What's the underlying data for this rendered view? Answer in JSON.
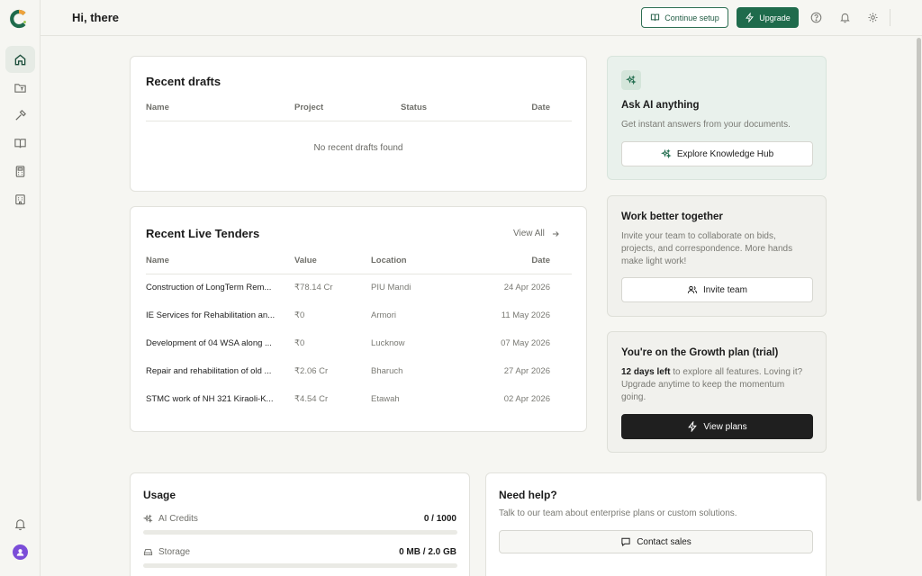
{
  "header": {
    "greeting": "Hi, there",
    "continue_setup": "Continue setup",
    "upgrade": "Upgrade"
  },
  "sidebar": {
    "items": [
      {
        "name": "home",
        "icon": "home-icon",
        "active": true
      },
      {
        "name": "projects",
        "icon": "folder-icon"
      },
      {
        "name": "tools",
        "icon": "hammer-icon"
      },
      {
        "name": "library",
        "icon": "book-icon"
      },
      {
        "name": "calculator",
        "icon": "calculator-icon"
      },
      {
        "name": "organization",
        "icon": "building-icon"
      }
    ]
  },
  "drafts": {
    "title": "Recent drafts",
    "columns": [
      "Name",
      "Project",
      "Status",
      "Date"
    ],
    "empty": "No recent drafts found"
  },
  "tenders": {
    "title": "Recent Live Tenders",
    "view_all": "View All",
    "columns": [
      "Name",
      "Value",
      "Location",
      "Date"
    ],
    "rows": [
      {
        "name": "Construction of LongTerm Rem...",
        "value": "₹78.14 Cr",
        "location": "PIU Mandi",
        "date": "24 Apr 2026"
      },
      {
        "name": "IE Services for Rehabilitation an...",
        "value": "₹0",
        "location": "Armori",
        "date": "11 May 2026"
      },
      {
        "name": "Development of 04 WSA along ...",
        "value": "₹0",
        "location": "Lucknow",
        "date": "07 May 2026"
      },
      {
        "name": "Repair and rehabilitation of old ...",
        "value": "₹2.06 Cr",
        "location": "Bharuch",
        "date": "27 Apr 2026"
      },
      {
        "name": "STMC work of NH 321 Kiraoli-K...",
        "value": "₹4.54 Cr",
        "location": "Etawah",
        "date": "02 Apr 2026"
      }
    ]
  },
  "ask_ai": {
    "title": "Ask AI anything",
    "text": "Get instant answers from your documents.",
    "button": "Explore Knowledge Hub"
  },
  "team": {
    "title": "Work better together",
    "text": "Invite your team to collaborate on bids, projects, and correspondence. More hands make light work!",
    "button": "Invite team"
  },
  "plan": {
    "title": "You're on the Growth plan (trial)",
    "days_left": "12 days left",
    "text": " to explore all features. Loving it? Upgrade anytime to keep the momentum going.",
    "button": "View plans"
  },
  "usage": {
    "title": "Usage",
    "ai_credits_label": "AI Credits",
    "ai_credits_value": "0 / 1000",
    "ai_credits_fraction": 0,
    "storage_label": "Storage",
    "storage_value": "0 MB / 2.0 GB",
    "storage_fraction": 0
  },
  "help": {
    "title": "Need help?",
    "text": "Talk to our team about enterprise plans or custom solutions.",
    "button": "Contact sales"
  },
  "colors": {
    "accent": "#1f6b4c",
    "avatar": "#7b4dd8",
    "logo_orange": "#f0a23a"
  }
}
